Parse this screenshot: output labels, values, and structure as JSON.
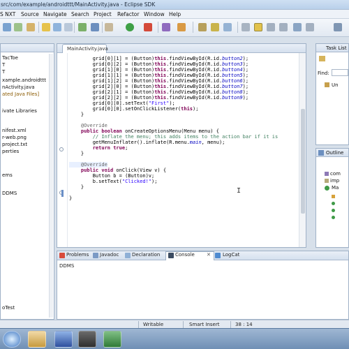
{
  "window": {
    "title": "src/com/example/androidttt/MainActivity.java - Eclipse SDK"
  },
  "menu": [
    "S NXT",
    "Source",
    "Navigate",
    "Search",
    "Project",
    "Refactor",
    "Window",
    "Help"
  ],
  "explorer": {
    "items": [
      "TacToe",
      "T",
      "T",
      "xample.androidttt",
      "nActivity.java",
      "ated Java Files]",
      "ivate Libraries",
      "nifest.xml",
      "r-web.png",
      "project.txt",
      "perties",
      "ems",
      "DDMS"
    ],
    "footer": "oTest"
  },
  "editor": {
    "tab_label": "MainActivity.java",
    "tab_close": "✕"
  },
  "tasklist": {
    "title": "Task List",
    "find_label": "Find:",
    "un_label": "Un"
  },
  "outline": {
    "title": "Outline",
    "items": [
      "com",
      "imp",
      "Ma"
    ]
  },
  "bottom": {
    "tabs": [
      "Problems",
      "Javadoc",
      "Declaration",
      "Console",
      "LogCat"
    ],
    "console_line": "DDMS"
  },
  "status": {
    "writable": "Writable",
    "insert_mode": "Smart Insert",
    "position": "38 : 14"
  }
}
